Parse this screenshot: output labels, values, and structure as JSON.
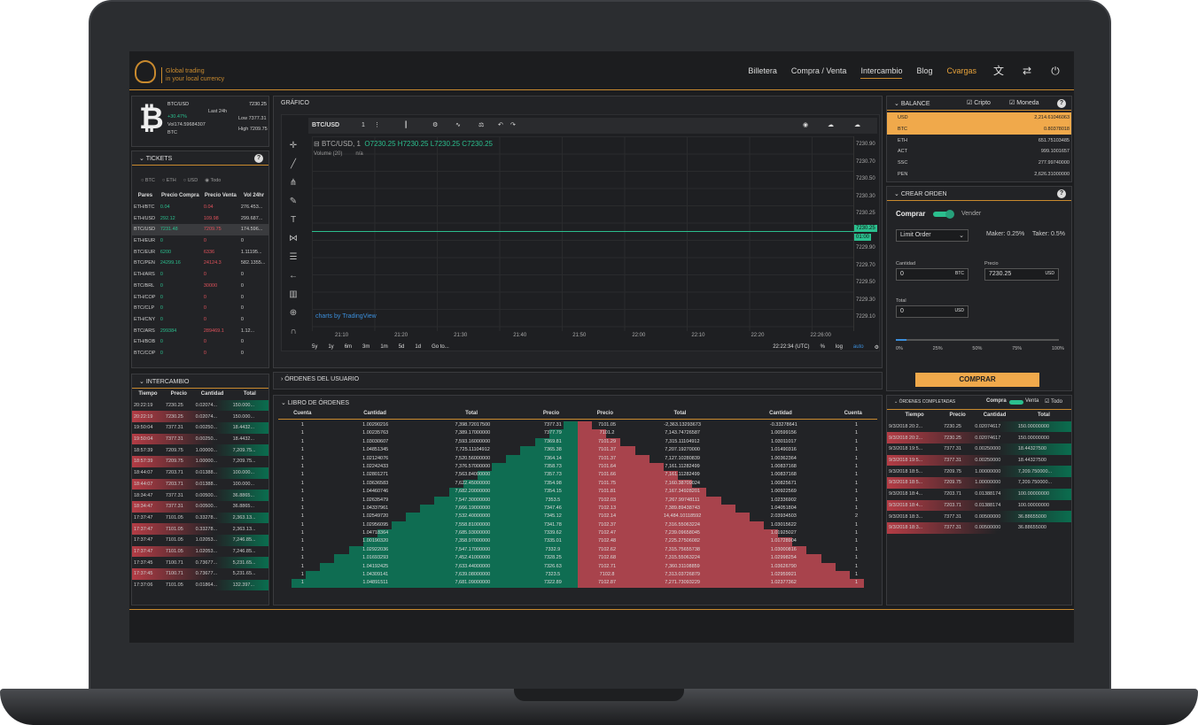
{
  "header": {
    "tagline_1": "Global trading",
    "tagline_2": "in your local currency",
    "nav": [
      "Billetera",
      "Compra / Venta",
      "Intercambio",
      "Blog"
    ],
    "user": "Cvargas"
  },
  "ticker": {
    "pair": "BTC/USD",
    "price": "7230.25",
    "change": "+30.47%",
    "last_label": "Last 24h",
    "vol": "Vol174.59684307",
    "coin": "BTC",
    "low": "Low 7377.31",
    "high": "High 7209.75"
  },
  "tickets": {
    "title": "TICKETS",
    "filters": [
      "BTC",
      "ETH",
      "USD",
      "Todo"
    ],
    "headers": [
      "Pares",
      "Precio Compra",
      "Precio Venta",
      "Vol 24hr"
    ],
    "rows": [
      [
        "ETH/BTC",
        "0.04",
        "0.04",
        "276.453..."
      ],
      [
        "ETH/USD",
        "292.12",
        "109.98",
        "299.687..."
      ],
      [
        "BTC/USD",
        "7231.48",
        "7209.75",
        "174.596..."
      ],
      [
        "ETH/EUR",
        "0",
        "0",
        "0"
      ],
      [
        "BTC/EUR",
        "6200",
        "6336",
        "1.11195..."
      ],
      [
        "BTC/PEN",
        "24299.16",
        "24124.3",
        "582.1355..."
      ],
      [
        "ETH/ARS",
        "0",
        "0",
        "0"
      ],
      [
        "BTC/BRL",
        "0",
        "30000",
        "0"
      ],
      [
        "ETH/COP",
        "0",
        "0",
        "0"
      ],
      [
        "BTC/CLP",
        "0",
        "0",
        "0"
      ],
      [
        "ETH/CNY",
        "0",
        "0",
        "0"
      ],
      [
        "BTC/ARS",
        "299384",
        "289469.1",
        "1.12..."
      ],
      [
        "ETH/BOB",
        "0",
        "0",
        "0"
      ],
      [
        "BTC/COP",
        "0",
        "0",
        "0"
      ]
    ]
  },
  "intercambio": {
    "title": "INTERCAMBIO",
    "headers": [
      "Tiempo",
      "Precio",
      "Cantidad",
      "Total"
    ],
    "rows": [
      [
        "20:22:19",
        "7230.25",
        "0.02074...",
        "150.000..."
      ],
      [
        "20:22:19",
        "7230.25",
        "0.02074...",
        "150.000..."
      ],
      [
        "19:50:04",
        "7377.31",
        "0.00250...",
        "18.4432..."
      ],
      [
        "19:50:04",
        "7377.31",
        "0.00250...",
        "18.4432..."
      ],
      [
        "18:57:39",
        "7209.75",
        "1.00000...",
        "7,209.75..."
      ],
      [
        "18:57:39",
        "7209.75",
        "1.00000...",
        "7,209.75..."
      ],
      [
        "18:44:07",
        "7203.71",
        "0.01388...",
        "100.000..."
      ],
      [
        "18:44:07",
        "7203.71",
        "0.01388...",
        "100.000..."
      ],
      [
        "18:34:47",
        "7377.31",
        "0.00500...",
        "36.8865..."
      ],
      [
        "18:34:47",
        "7377.31",
        "0.00500...",
        "36.8865..."
      ],
      [
        "17:37:47",
        "7101.05",
        "0.33278...",
        "2,363.13..."
      ],
      [
        "17:37:47",
        "7101.05",
        "0.33278...",
        "2,363.13..."
      ],
      [
        "17:37:47",
        "7101.05",
        "1.02053...",
        "7,246.85..."
      ],
      [
        "17:37:47",
        "7101.05",
        "1.02053...",
        "7,246.85..."
      ],
      [
        "17:37:45",
        "7100.71",
        "0.73677...",
        "5,231.65..."
      ],
      [
        "17:37:45",
        "7100.71",
        "0.73677...",
        "5,231.65..."
      ],
      [
        "17:37:06",
        "7101.05",
        "0.01864...",
        "132.397..."
      ]
    ]
  },
  "chart": {
    "title": "GRÁFICO",
    "symbol": "BTC/USD",
    "interval": "1",
    "legend": "BTC/USD, 1",
    "o": "7230.25",
    "h": "7230.25",
    "l": "7230.25",
    "c": "7230.25",
    "volume": "Volume (20)",
    "na": "n/a",
    "watermark": "charts by TradingView",
    "yticks": [
      "7230.90",
      "7230.70",
      "7230.50",
      "7230.30",
      "7230.25",
      "7230.10",
      "7229.90",
      "7229.70",
      "7229.50",
      "7229.30",
      "7229.10"
    ],
    "xticks": [
      "21:10",
      "21:20",
      "21:30",
      "21:40",
      "21:50",
      "22:00",
      "22:10",
      "22:20",
      "22:26:00"
    ],
    "ranges": [
      "5y",
      "1y",
      "6m",
      "3m",
      "1m",
      "5d",
      "1d",
      "Go to..."
    ],
    "time": "22:22:34 (UTC)",
    "pct": "%",
    "log": "log",
    "auto": "auto",
    "price_tag": "7230.25",
    "count_tag": "01:00"
  },
  "user_orders": {
    "title": "ÓRDENES DEL USUARIO"
  },
  "orderbook": {
    "title": "LIBRO DE ÓRDENES",
    "headers": [
      "Cuenta",
      "Cantidad",
      "Total",
      "Precio",
      "Precio",
      "Total",
      "Cantidad",
      "Cuenta"
    ],
    "bids": [
      [
        "1",
        "1.00290216",
        "7,398.72017500",
        "7377.31"
      ],
      [
        "1",
        "1.00235763",
        "7,389.17000000",
        "7377.79"
      ],
      [
        "1",
        "1.03030607",
        "7,593.16000000",
        "7369.81"
      ],
      [
        "1",
        "1.04851345",
        "7,725.11104912",
        "7365.38"
      ],
      [
        "1",
        "1.02124076",
        "7,520.56000000",
        "7364.14"
      ],
      [
        "1",
        "1.02242433",
        "7,376.57000000",
        "7358.73"
      ],
      [
        "1",
        "1.02801271",
        "7,563.84000000",
        "7357.73"
      ],
      [
        "1",
        "1.03636583",
        "7,622.45000000",
        "7354.98"
      ],
      [
        "1",
        "1.04460746",
        "7,682.20000000",
        "7354.15"
      ],
      [
        "1",
        "1.02635479",
        "7,547.30000000",
        "7353.5"
      ],
      [
        "1",
        "1.04337961",
        "7,666.19000000",
        "7347.46"
      ],
      [
        "1",
        "1.02549720",
        "7,532.40000000",
        "7345.12"
      ],
      [
        "1",
        "1.02956095",
        "7,558.81000000",
        "7341.78"
      ],
      [
        "1",
        "1.04718364",
        "7,685.93000000",
        "7339.62"
      ],
      [
        "1",
        "1.00190320",
        "7,358.97000000",
        "7335.01"
      ],
      [
        "1",
        "1.02922036",
        "7,547.17000000",
        "7332.9"
      ],
      [
        "1",
        "1.01693293",
        "7,452.41000000",
        "7328.25"
      ],
      [
        "1",
        "1.04192425",
        "7,633.44000000",
        "7326.63"
      ],
      [
        "1",
        "1.04309141",
        "7,639.08000000",
        "7323.5"
      ],
      [
        "1",
        "1.04891511",
        "7,681.09000000",
        "7322.89"
      ]
    ],
    "asks": [
      [
        "7101.05",
        "-2,363.13293673",
        "-0.33278641",
        "1"
      ],
      [
        "7101.2",
        "7,143.74726587",
        "1.00599156",
        "1"
      ],
      [
        "7101.29",
        "7,315.11104912",
        "1.03011017",
        "1"
      ],
      [
        "7101.37",
        "7,207.19270000",
        "1.01490316",
        "1"
      ],
      [
        "7101.37",
        "7,127.10280839",
        "1.00362364",
        "1"
      ],
      [
        "7101.64",
        "7,161.11282499",
        "1.00837168",
        "1"
      ],
      [
        "7101.66",
        "7,161.11282499",
        "1.00837168",
        "1"
      ],
      [
        "7101.75",
        "7,160.38709024",
        "1.00825671",
        "1"
      ],
      [
        "7101.81",
        "7,167.34928201",
        "1.00922569",
        "1"
      ],
      [
        "7102.03",
        "7,267.99748111",
        "1.02336902",
        "1"
      ],
      [
        "7102.13",
        "7,389.89438743",
        "1.04051804",
        "1"
      ],
      [
        "7102.14",
        "14,484.10118592",
        "2.03934503",
        "2"
      ],
      [
        "7102.37",
        "7,316.55063224",
        "1.03015622",
        "1"
      ],
      [
        "7102.47",
        "7,239.09658045",
        "1.01925027",
        "1"
      ],
      [
        "7102.48",
        "7,225.27506082",
        "1.01728904",
        "1"
      ],
      [
        "7102.62",
        "7,315.75655738",
        "1.03000816",
        "1"
      ],
      [
        "7102.68",
        "7,315.55063224",
        "1.02998254",
        "1"
      ],
      [
        "7102.71",
        "7,360.31108859",
        "1.03626790",
        "1"
      ],
      [
        "7102.8",
        "7,313.03726879",
        "1.02959921",
        "1"
      ],
      [
        "7102.87",
        "7,271.73093229",
        "1.02377362",
        "1"
      ]
    ]
  },
  "balance": {
    "title": "BALANCE",
    "chk1": "Cripto",
    "chk2": "Moneda",
    "rows": [
      [
        "USD",
        "2,214.61046063"
      ],
      [
        "BTC",
        "0.80378018"
      ],
      [
        "ETH",
        "651.75103485"
      ],
      [
        "ACT",
        "999.1001657"
      ],
      [
        "SSC",
        "277.99740000"
      ],
      [
        "PEN",
        "2,626.31000000"
      ]
    ]
  },
  "order": {
    "title": "CREAR ORDEN",
    "buy": "Comprar",
    "sell": "Vender",
    "type": "Limit Order",
    "maker": "Maker: 0.25%",
    "taker": "Taker: 0.5%",
    "qty_label": "Cantidad",
    "qty": "0",
    "qty_unit": "BTC",
    "price_label": "Precio",
    "price": "7230.25",
    "price_unit": "USD",
    "total_label": "Total",
    "total": "0",
    "total_unit": "USD",
    "pcts": [
      "0%",
      "25%",
      "50%",
      "75%",
      "100%"
    ],
    "submit": "COMPRAR"
  },
  "completed": {
    "title": "ÓRDENES COMPLETADAS",
    "buy": "Compra",
    "sell": "Venta",
    "all": "Todo",
    "headers": [
      "Tiempo",
      "Precio",
      "Cantidad",
      "Total"
    ],
    "rows": [
      [
        "9/3/2018 20:2...",
        "7230.25",
        "0.02074617",
        "150.00000000"
      ],
      [
        "9/3/2018 20:2...",
        "7230.25",
        "0.02074617",
        "150.00000000"
      ],
      [
        "9/3/2018 19:5...",
        "7377.31",
        "0.00250000",
        "18.44327500"
      ],
      [
        "9/3/2018 19:5...",
        "7377.31",
        "0.00250000",
        "18.44327500"
      ],
      [
        "9/3/2018 18:5...",
        "7209.75",
        "1.00000000",
        "7,209.750000..."
      ],
      [
        "9/3/2018 18:5...",
        "7209.75",
        "1.00000000",
        "7,209.750000..."
      ],
      [
        "9/3/2018 18:4...",
        "7203.71",
        "0.01388174",
        "100.00000000"
      ],
      [
        "9/3/2018 18:4...",
        "7203.71",
        "0.01388174",
        "100.00000000"
      ],
      [
        "9/3/2018 18:3...",
        "7377.31",
        "0.00500000",
        "36.88655000"
      ],
      [
        "9/3/2018 18:3...",
        "7377.31",
        "0.00500000",
        "36.88655000"
      ]
    ]
  }
}
